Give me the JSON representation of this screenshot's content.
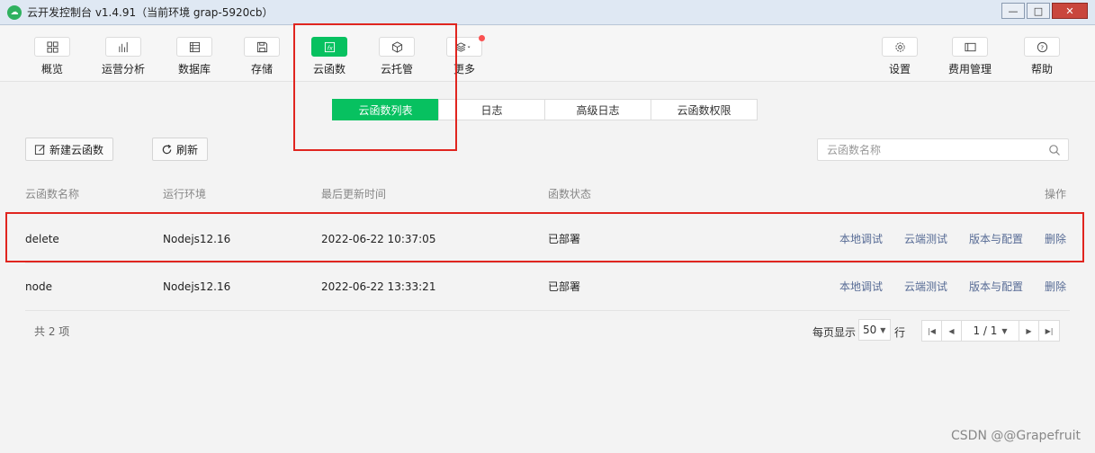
{
  "window": {
    "title": "云开发控制台 v1.4.91（当前环境 grap-5920cb）",
    "buttons": {
      "minimize": "—",
      "maximize": "□",
      "close": "✕"
    }
  },
  "toolbar": {
    "left": [
      {
        "label": "概览",
        "icon": "grid-icon"
      },
      {
        "label": "运营分析",
        "icon": "bar-chart-icon"
      },
      {
        "label": "数据库",
        "icon": "database-icon"
      },
      {
        "label": "存储",
        "icon": "save-icon"
      },
      {
        "label": "云函数",
        "icon": "function-icon",
        "active": true
      },
      {
        "label": "云托管",
        "icon": "cube-icon"
      },
      {
        "label": "更多",
        "icon": "layers-icon"
      }
    ],
    "right": [
      {
        "label": "设置",
        "icon": "gear-icon"
      },
      {
        "label": "费用管理",
        "icon": "card-icon"
      },
      {
        "label": "帮助",
        "icon": "help-icon"
      }
    ]
  },
  "tabs": [
    {
      "label": "云函数列表",
      "active": true
    },
    {
      "label": "日志"
    },
    {
      "label": "高级日志"
    },
    {
      "label": "云函数权限"
    }
  ],
  "actions": {
    "new_label": "新建云函数",
    "refresh_label": "刷新"
  },
  "search": {
    "placeholder": "云函数名称"
  },
  "table": {
    "columns": [
      "云函数名称",
      "运行环境",
      "最后更新时间",
      "函数状态",
      "操作"
    ],
    "rows": [
      {
        "name": "delete",
        "runtime": "Nodejs12.16",
        "updated": "2022-06-22 10:37:05",
        "status": "已部署"
      },
      {
        "name": "node",
        "runtime": "Nodejs12.16",
        "updated": "2022-06-22 13:33:21",
        "status": "已部署"
      }
    ],
    "ops": [
      "本地调试",
      "云端测试",
      "版本与配置",
      "删除"
    ]
  },
  "footer": {
    "count": "共 2 项",
    "per_page_label": "每页显示",
    "per_page_value": "50",
    "per_page_unit": "行",
    "page": "1 / 1"
  },
  "watermark": "CSDN @@Grapefruit",
  "colors": {
    "accent": "#07c160",
    "link": "#576b95",
    "annotation": "#e0251f"
  }
}
